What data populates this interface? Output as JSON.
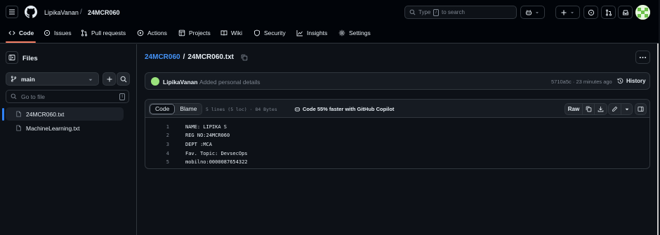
{
  "header": {
    "owner": "LipikaVanan",
    "separator": "/",
    "repo": "24MCR060",
    "search_prefix": "Type",
    "search_key": "/",
    "search_suffix": "to search"
  },
  "repo_nav": [
    {
      "label": "Code",
      "icon": "code-icon",
      "active": true
    },
    {
      "label": "Issues",
      "icon": "issue-icon"
    },
    {
      "label": "Pull requests",
      "icon": "pull-request-icon"
    },
    {
      "label": "Actions",
      "icon": "play-icon"
    },
    {
      "label": "Projects",
      "icon": "table-icon"
    },
    {
      "label": "Wiki",
      "icon": "book-icon"
    },
    {
      "label": "Security",
      "icon": "shield-icon"
    },
    {
      "label": "Insights",
      "icon": "graph-icon"
    },
    {
      "label": "Settings",
      "icon": "gear-icon"
    }
  ],
  "sidebar": {
    "title": "Files",
    "branch": "main",
    "goto_placeholder": "Go to file",
    "goto_key": "t",
    "files": [
      {
        "name": "24MCR060.txt",
        "active": true
      },
      {
        "name": "MachineLearning.txt",
        "active": false
      }
    ]
  },
  "main": {
    "repo_link": "24MCR060",
    "separator": "/",
    "file_name": "24MCR060.txt",
    "commit": {
      "author": "LipikaVanan",
      "message": "Added personal details",
      "meta": "5710a5c · 23 minutes ago",
      "history_label": "History"
    },
    "file_header": {
      "code_tab": "Code",
      "blame_tab": "Blame",
      "lines_info": "5 lines (5 loc) · 84 Bytes",
      "copilot": "Code 55% faster with GitHub Copilot",
      "raw_label": "Raw"
    },
    "lines": [
      {
        "num": "1",
        "text": "NAME: LIPIKA S"
      },
      {
        "num": "2",
        "text": "REG NO:24MCR060"
      },
      {
        "num": "3",
        "text": "DEPT :MCA"
      },
      {
        "num": "4",
        "text": "Fav. Topic: DevsecOps"
      },
      {
        "num": "5",
        "text": "mobilno:0000087654322"
      }
    ]
  },
  "colors": {
    "accent": "#4493f8",
    "nav_underline": "#f78166",
    "background": "#0d1117",
    "header_bg": "#010409"
  }
}
